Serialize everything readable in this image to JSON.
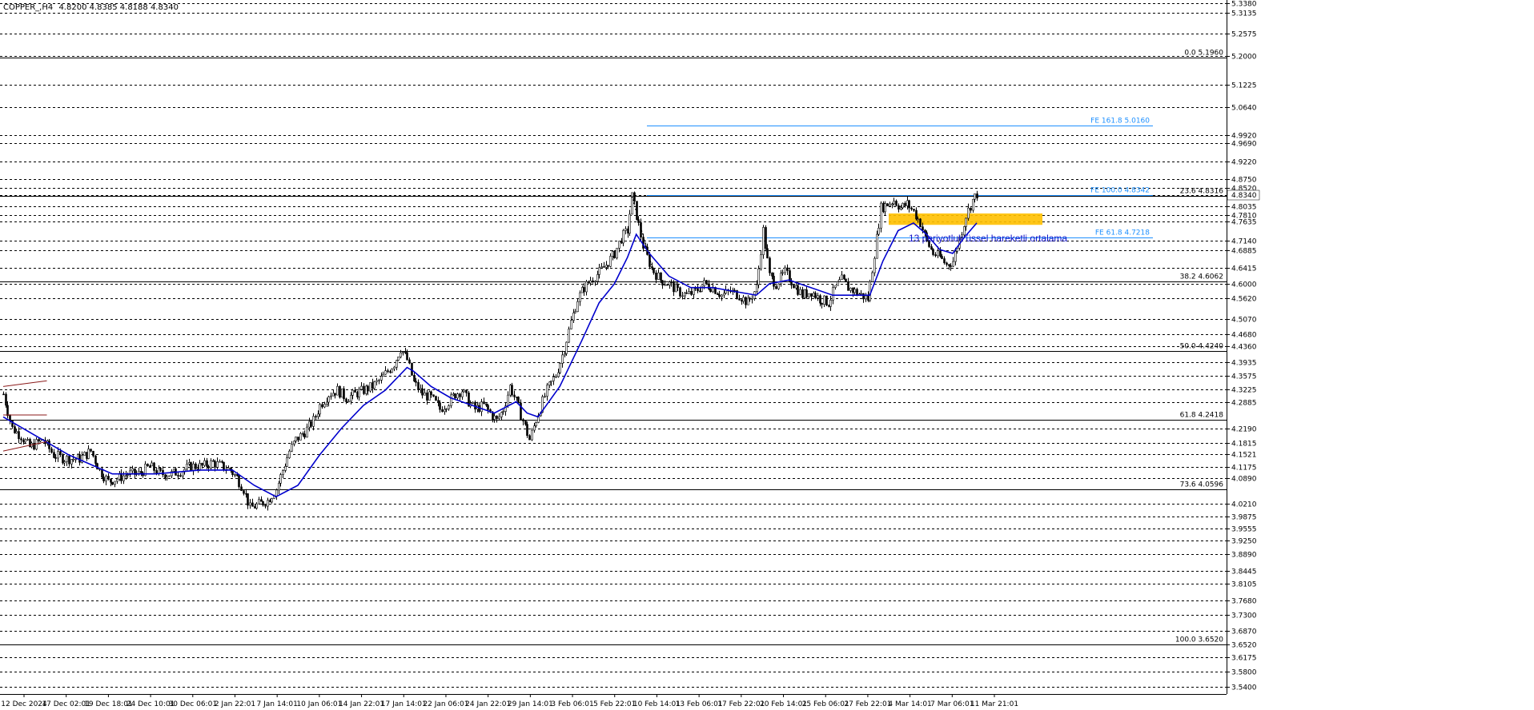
{
  "header": {
    "symbol": "COPPER_,H4",
    "ohlc": "4.8200 4.8385 4.8188 4.8340"
  },
  "colors": {
    "background": "#ffffff",
    "candle": "#000000",
    "ema": "#0000cd",
    "fe_line": "#1e90ff",
    "fib_line": "#000000",
    "grid": "#000000",
    "zone": "#ffc000",
    "annotation": "#1414c8"
  },
  "chart_data": {
    "type": "candlestick",
    "symbol": "COPPER_",
    "timeframe": "H4",
    "ylim": [
      3.53,
      5.34
    ],
    "price_ticks": [
      "5.3380",
      "5.3135",
      "5.2575",
      "5.2000",
      "5.1225",
      "5.0640",
      "4.9920",
      "4.9690",
      "4.9220",
      "4.8750",
      "4.8520",
      "4.8340",
      "4.8035",
      "4.7810",
      "4.7635",
      "4.7140",
      "4.6885",
      "4.6415",
      "4.6000",
      "4.5620",
      "4.5070",
      "4.4680",
      "4.4360",
      "4.3935",
      "4.3575",
      "4.3225",
      "4.2885",
      "4.2190",
      "4.1815",
      "4.1521",
      "4.1175",
      "4.0890",
      "4.0210",
      "3.9875",
      "3.9555",
      "3.9250",
      "3.8890",
      "3.8445",
      "3.8105",
      "3.7680",
      "3.7300",
      "3.6870",
      "3.6520",
      "3.6175",
      "3.5800",
      "3.5400"
    ],
    "time_ticks": [
      "12 Dec 2024",
      "17 Dec 02:01",
      "19 Dec 18:01",
      "24 Dec 10:01",
      "30 Dec 06:01",
      "2 Jan 22:01",
      "7 Jan 14:01",
      "10 Jan 06:01",
      "14 Jan 22:01",
      "17 Jan 14:01",
      "22 Jan 06:01",
      "24 Jan 22:01",
      "29 Jan 14:01",
      "3 Feb 06:01",
      "5 Feb 22:01",
      "10 Feb 14:01",
      "13 Feb 06:01",
      "17 Feb 22:01",
      "20 Feb 14:01",
      "25 Feb 06:01",
      "27 Feb 22:01",
      "4 Mar 14:01",
      "7 Mar 06:01",
      "11 Mar 21:01"
    ],
    "fib_levels": [
      {
        "label": "0.0 5.1960",
        "value": 5.196
      },
      {
        "label": "23.6 4.8316",
        "value": 4.8316
      },
      {
        "label": "38.2 4.6062",
        "value": 4.6062
      },
      {
        "label": "50.0 4.4240",
        "value": 4.424
      },
      {
        "label": "61.8 4.2418",
        "value": 4.2418
      },
      {
        "label": "73.6 4.0596",
        "value": 4.0596
      },
      {
        "label": "100.0 3.6520",
        "value": 3.652
      }
    ],
    "fe_levels": [
      {
        "label": "FE 161.8 5.0160",
        "value": 5.016
      },
      {
        "label": "FE 100.0 4.8342",
        "value": 4.8342
      },
      {
        "label": "FE 61.8 4.7218",
        "value": 4.7218
      }
    ],
    "zone": {
      "from": 4.755,
      "to": 4.785
    },
    "ema_period": 13,
    "close_path": [
      [
        0,
        4.31
      ],
      [
        8,
        4.22
      ],
      [
        16,
        4.2
      ],
      [
        24,
        4.17
      ],
      [
        36,
        4.19
      ],
      [
        46,
        4.15
      ],
      [
        56,
        4.14
      ],
      [
        70,
        4.14
      ],
      [
        80,
        4.16
      ],
      [
        88,
        4.11
      ],
      [
        96,
        4.08
      ],
      [
        106,
        4.09
      ],
      [
        114,
        4.1
      ],
      [
        124,
        4.1
      ],
      [
        134,
        4.12
      ],
      [
        144,
        4.1
      ],
      [
        154,
        4.1
      ],
      [
        164,
        4.11
      ],
      [
        172,
        4.12
      ],
      [
        182,
        4.12
      ],
      [
        192,
        4.13
      ],
      [
        200,
        4.12
      ],
      [
        208,
        4.11
      ],
      [
        214,
        4.09
      ],
      [
        220,
        4.06
      ],
      [
        226,
        4.01
      ],
      [
        234,
        4.02
      ],
      [
        242,
        4.03
      ],
      [
        250,
        4.06
      ],
      [
        256,
        4.11
      ],
      [
        262,
        4.16
      ],
      [
        268,
        4.19
      ],
      [
        276,
        4.21
      ],
      [
        284,
        4.24
      ],
      [
        290,
        4.28
      ],
      [
        298,
        4.31
      ],
      [
        306,
        4.32
      ],
      [
        314,
        4.3
      ],
      [
        322,
        4.31
      ],
      [
        330,
        4.32
      ],
      [
        338,
        4.33
      ],
      [
        346,
        4.35
      ],
      [
        352,
        4.37
      ],
      [
        358,
        4.39
      ],
      [
        364,
        4.43
      ],
      [
        370,
        4.4
      ],
      [
        376,
        4.34
      ],
      [
        384,
        4.31
      ],
      [
        392,
        4.3
      ],
      [
        400,
        4.27
      ],
      [
        408,
        4.29
      ],
      [
        414,
        4.31
      ],
      [
        420,
        4.32
      ],
      [
        426,
        4.29
      ],
      [
        432,
        4.27
      ],
      [
        440,
        4.28
      ],
      [
        446,
        4.26
      ],
      [
        452,
        4.24
      ],
      [
        458,
        4.27
      ],
      [
        464,
        4.33
      ],
      [
        470,
        4.29
      ],
      [
        476,
        4.24
      ],
      [
        482,
        4.19
      ],
      [
        490,
        4.26
      ],
      [
        498,
        4.32
      ],
      [
        506,
        4.36
      ],
      [
        514,
        4.43
      ],
      [
        520,
        4.5
      ],
      [
        526,
        4.56
      ],
      [
        532,
        4.59
      ],
      [
        538,
        4.61
      ],
      [
        546,
        4.63
      ],
      [
        552,
        4.65
      ],
      [
        560,
        4.68
      ],
      [
        566,
        4.72
      ],
      [
        572,
        4.74
      ],
      [
        576,
        4.83
      ],
      [
        580,
        4.78
      ],
      [
        586,
        4.7
      ],
      [
        594,
        4.64
      ],
      [
        602,
        4.61
      ],
      [
        610,
        4.6
      ],
      [
        618,
        4.58
      ],
      [
        626,
        4.57
      ],
      [
        634,
        4.58
      ],
      [
        642,
        4.6
      ],
      [
        650,
        4.59
      ],
      [
        658,
        4.57
      ],
      [
        666,
        4.58
      ],
      [
        674,
        4.57
      ],
      [
        682,
        4.55
      ],
      [
        690,
        4.59
      ],
      [
        696,
        4.74
      ],
      [
        702,
        4.62
      ],
      [
        708,
        4.6
      ],
      [
        716,
        4.63
      ],
      [
        724,
        4.6
      ],
      [
        732,
        4.57
      ],
      [
        740,
        4.58
      ],
      [
        748,
        4.56
      ],
      [
        756,
        4.55
      ],
      [
        762,
        4.59
      ],
      [
        768,
        4.61
      ],
      [
        774,
        4.59
      ],
      [
        780,
        4.58
      ],
      [
        786,
        4.57
      ],
      [
        792,
        4.56
      ],
      [
        798,
        4.68
      ],
      [
        804,
        4.8
      ],
      [
        810,
        4.81
      ],
      [
        816,
        4.82
      ],
      [
        822,
        4.8
      ],
      [
        828,
        4.81
      ],
      [
        834,
        4.79
      ],
      [
        840,
        4.76
      ],
      [
        846,
        4.71
      ],
      [
        852,
        4.68
      ],
      [
        858,
        4.67
      ],
      [
        864,
        4.65
      ],
      [
        870,
        4.66
      ],
      [
        876,
        4.72
      ],
      [
        882,
        4.78
      ],
      [
        888,
        4.82
      ],
      [
        892,
        4.836
      ]
    ],
    "ema_path": [
      [
        0,
        4.25
      ],
      [
        30,
        4.2
      ],
      [
        60,
        4.15
      ],
      [
        100,
        4.1
      ],
      [
        140,
        4.1
      ],
      [
        180,
        4.11
      ],
      [
        210,
        4.11
      ],
      [
        230,
        4.07
      ],
      [
        250,
        4.04
      ],
      [
        270,
        4.07
      ],
      [
        290,
        4.15
      ],
      [
        310,
        4.22
      ],
      [
        330,
        4.28
      ],
      [
        350,
        4.32
      ],
      [
        370,
        4.38
      ],
      [
        376,
        4.37
      ],
      [
        392,
        4.33
      ],
      [
        410,
        4.3
      ],
      [
        430,
        4.28
      ],
      [
        450,
        4.26
      ],
      [
        470,
        4.29
      ],
      [
        480,
        4.26
      ],
      [
        490,
        4.25
      ],
      [
        510,
        4.33
      ],
      [
        530,
        4.45
      ],
      [
        546,
        4.55
      ],
      [
        560,
        4.6
      ],
      [
        572,
        4.67
      ],
      [
        580,
        4.73
      ],
      [
        592,
        4.68
      ],
      [
        610,
        4.62
      ],
      [
        630,
        4.59
      ],
      [
        650,
        4.59
      ],
      [
        670,
        4.58
      ],
      [
        690,
        4.57
      ],
      [
        702,
        4.6
      ],
      [
        720,
        4.61
      ],
      [
        740,
        4.59
      ],
      [
        760,
        4.57
      ],
      [
        780,
        4.57
      ],
      [
        794,
        4.57
      ],
      [
        806,
        4.66
      ],
      [
        820,
        4.74
      ],
      [
        834,
        4.76
      ],
      [
        846,
        4.73
      ],
      [
        858,
        4.69
      ],
      [
        870,
        4.68
      ],
      [
        880,
        4.72
      ],
      [
        892,
        4.76
      ]
    ],
    "annotation": "13 periyotluk üssel hareketli ortalama"
  }
}
